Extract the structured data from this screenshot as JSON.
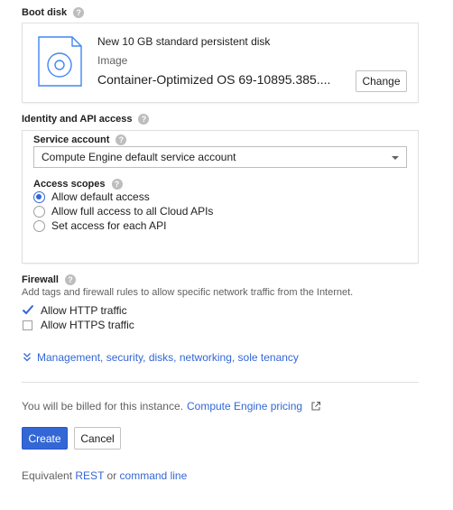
{
  "boot_disk": {
    "title": "Boot disk",
    "disk_name": "New 10 GB standard persistent disk",
    "disk_type_label": "Image",
    "disk_image": "Container-Optimized OS 69-10895.385....",
    "change_label": "Change"
  },
  "identity": {
    "title": "Identity and API access",
    "service_account_label": "Service account",
    "service_account_value": "Compute Engine default service account",
    "access_scopes_label": "Access scopes",
    "scopes": [
      {
        "label": "Allow default access",
        "selected": true
      },
      {
        "label": "Allow full access to all Cloud APIs",
        "selected": false
      },
      {
        "label": "Set access for each API",
        "selected": false
      }
    ]
  },
  "firewall": {
    "title": "Firewall",
    "description": "Add tags and firewall rules to allow specific network traffic from the Internet.",
    "http_label": "Allow HTTP traffic",
    "http_checked": true,
    "https_label": "Allow HTTPS traffic",
    "https_checked": false
  },
  "management_link": "Management, security, disks, networking, sole tenancy",
  "billing": {
    "text": "You will be billed for this instance.",
    "pricing_link": "Compute Engine pricing"
  },
  "actions": {
    "create_label": "Create",
    "cancel_label": "Cancel"
  },
  "equivalent": {
    "prefix": "Equivalent",
    "rest_link": "REST",
    "or": "or",
    "cmd_link": "command line"
  },
  "colors": {
    "accent": "#3367d6",
    "help_icon": "#bdbdbd"
  }
}
